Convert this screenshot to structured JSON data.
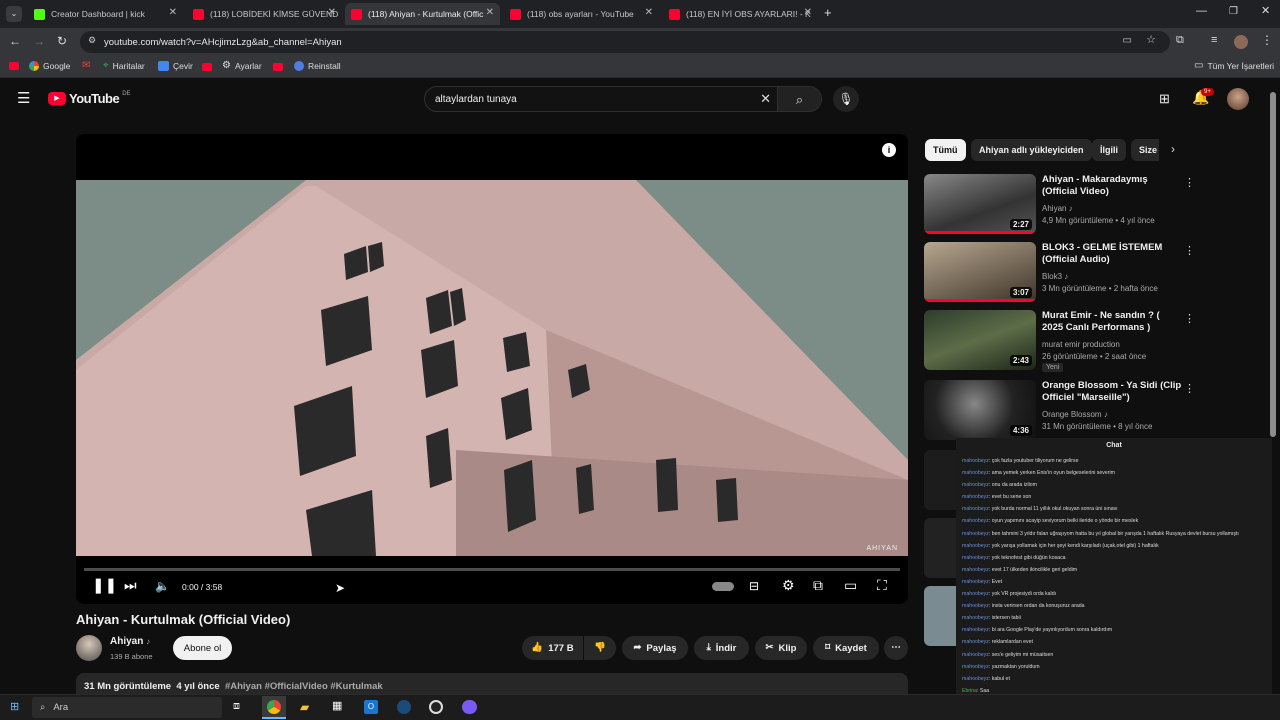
{
  "browser": {
    "tabs": [
      {
        "label": "Creator Dashboard | kick",
        "color": "#53fc18"
      },
      {
        "label": "(118) LOBİDEKİ KİMSE GÜVEND",
        "color": "#ff0033"
      },
      {
        "label": "(118) Ahiyan - Kurtulmak (Offic",
        "color": "#ff0033"
      },
      {
        "label": "(118) obs ayarları - YouTube",
        "color": "#ff0033"
      },
      {
        "label": "(118) EN İYİ OBS AYARLARI! - K",
        "color": "#ff0033"
      }
    ],
    "url": "youtube.com/watch?v=AHcjimzLzg&ab_channel=Ahiyan",
    "bookmarks": [
      "Google",
      "Haritalar",
      "Çevir",
      "Ayarlar",
      "Reinstall"
    ],
    "all_bookmarks": "Tüm Yer İşaretleri"
  },
  "youtube": {
    "logo": "YouTube",
    "region": "DE",
    "search_query": "altaylardan tunaya",
    "notifications": "9+"
  },
  "player": {
    "time": "0:00 / 3:58",
    "progress": 0.0,
    "watermark": "AHIYAN"
  },
  "video": {
    "title": "Ahiyan - Kurtulmak (Official Video)",
    "channel": "Ahiyan",
    "subscribers": "139 B abone",
    "subscribe_label": "Abone ol",
    "likes": "177 B",
    "share": "Paylaş",
    "download": "İndir",
    "clip": "Klip",
    "save": "Kaydet",
    "views": "31 Mn görüntüleme",
    "age": "4 yıl önce",
    "tags": "#Ahiyan #OfficialVideo #Kurtulmak"
  },
  "chips": [
    "Tümü",
    "Ahiyan adlı yükleyiciden",
    "İlgili",
    "Size"
  ],
  "recommendations": [
    {
      "title": "Ahiyan - Makaradaymış (Official Video)",
      "channel": "Ahiyan",
      "meta": "4,9 Mn görüntüleme • 4 yıl önce",
      "duration": "2:27",
      "badge": ""
    },
    {
      "title": "BLOK3 - GELME İSTEMEM (Official Audio)",
      "channel": "Blok3",
      "meta": "3 Mn görüntüleme • 2 hafta önce",
      "duration": "3:07",
      "badge": ""
    },
    {
      "title": "Murat Emir - Ne sandın ? ( 2025 Canlı Performans )",
      "channel": "murat emir production",
      "meta": "26 görüntüleme • 2 saat önce",
      "duration": "2:43",
      "badge": "Yeni"
    },
    {
      "title": "Orange Blossom - Ya Sidi (Clip Officiel \"Marseille\")",
      "channel": "Orange Blossom",
      "meta": "31 Mn görüntüleme • 8 yıl önce",
      "duration": "4:36",
      "badge": ""
    }
  ],
  "chat": {
    "title": "Chat",
    "messages": [
      {
        "user": "mahoobeyz",
        "text": "çok fazla youtuber tiliyorum ne gelirse"
      },
      {
        "user": "mahoobeyz",
        "text": "ama yemek yerken Enis'in oyun belgeselerini severim"
      },
      {
        "user": "mahoobeyz",
        "text": "onu da arada izliom"
      },
      {
        "user": "mahoobeyz",
        "text": "evet bu sene son"
      },
      {
        "user": "mahoobeyz",
        "text": "yok burda normal 11 yıllık okul okuyan sonra üni sınavı"
      },
      {
        "user": "mahoobeyz",
        "text": "oyun yapımını acayip seviyorum belki ileride o yönde bir meslek"
      },
      {
        "user": "mahoobeyz",
        "text": "ben tahmini 3 yıldır falan uğraşıyom hatta bu yıl global bir yarışda 1 haftalık Rusyaya devlet bursu yollamıştı"
      },
      {
        "user": "mahoobeyz",
        "text": "yok yarışa yollamak için her şeyi kendi karşıladı (uçak,otel gibi) 1 haftalık"
      },
      {
        "user": "mahoobeyz",
        "text": "yok teknofest gibi düğün kosaca"
      },
      {
        "user": "mahoobeyz",
        "text": "evet 17 ülkeden ikincilikle geri geldim"
      },
      {
        "user": "mahoobeyz",
        "text": "Evet"
      },
      {
        "user": "mahoobeyz",
        "text": "yok VR projesiydi orda kaldı"
      },
      {
        "user": "mahoobeyz",
        "text": "insta verirsen ordan da konuşuruz arada"
      },
      {
        "user": "mahoobeyz",
        "text": "istersen tabii"
      },
      {
        "user": "mahoobeyz",
        "text": "bi ara Google Play'de yayınlıyordum sonra kaldırdım"
      },
      {
        "user": "mahoobeyz",
        "text": "reklamlardan evet"
      },
      {
        "user": "mahoobeyz",
        "text": "ses'e geliyim mi müsaitsen"
      },
      {
        "user": "mahoobeyz",
        "text": "yazmaktan yoruldum"
      },
      {
        "user": "mahoobeyz",
        "text": "kabul et"
      },
      {
        "user": "Ebrina",
        "text": "Saa"
      }
    ]
  },
  "taskbar": {
    "search": "Ara"
  }
}
